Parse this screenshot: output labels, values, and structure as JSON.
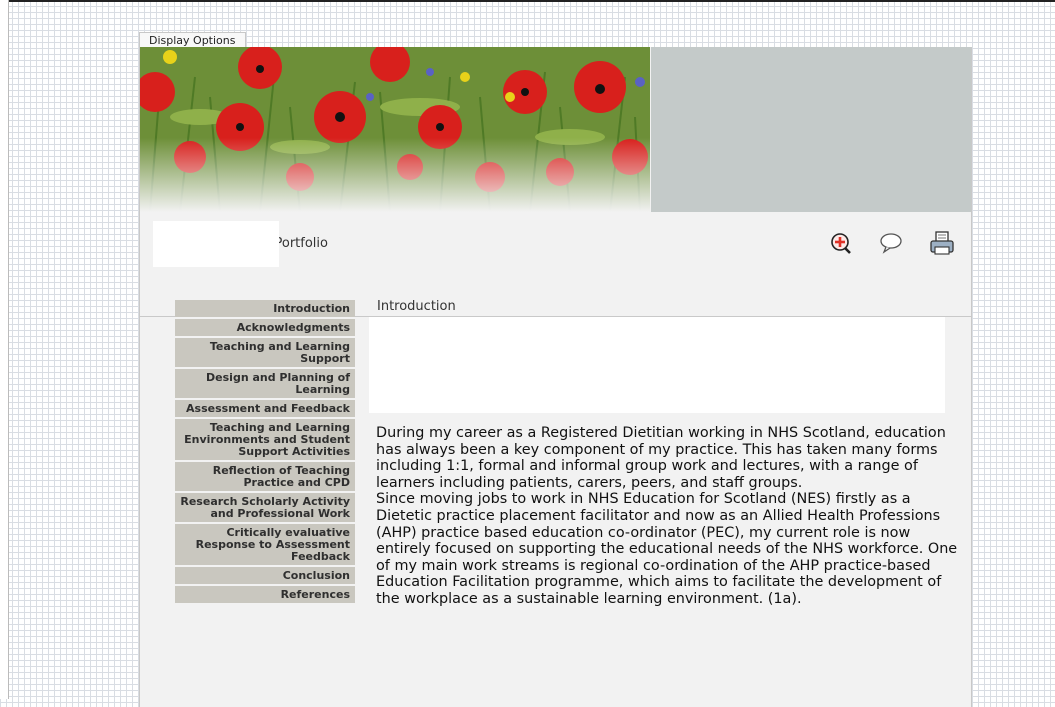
{
  "display_options_tab": "Display Options",
  "header": {
    "title": "y Education in Action Portfolio"
  },
  "toolbar": {
    "icons": [
      "zoom-in-icon",
      "comment-icon",
      "print-icon"
    ]
  },
  "nav": {
    "items": [
      "Introduction",
      "Acknowledgments",
      "Teaching and Learning Support",
      "Design and Planning of Learning",
      "Assessment and Feedback",
      "Teaching and Learning Environments and Student Support Activities",
      "Reflection of Teaching Practice and CPD",
      "Research Scholarly Activity and Professional Work",
      "Critically evaluative Response to Assessment Feedback",
      "Conclusion",
      "References"
    ]
  },
  "content": {
    "section_title": "Introduction",
    "paragraphs": [
      "During my career as a Registered Dietitian working in NHS Scotland, education has always been a key component of my practice. This has taken many forms including 1:1, formal and informal group work and lectures, with a range of learners including patients, carers, peers, and staff groups.",
      "Since moving jobs to work in NHS Education for Scotland (NES) firstly as a Dietetic practice placement facilitator and now as an Allied Health Professions (AHP) practice based education co-ordinator (PEC), my current role is now entirely focused on supporting the educational needs of the NHS workforce. One of my main work streams is regional co-ordination of the AHP practice-based Education Facilitation programme, which aims to facilitate the development of the workplace as a sustainable learning environment. (1a)."
    ]
  },
  "colors": {
    "nav_bg": "#c9c7bf",
    "panel_bg": "#f2f2f2",
    "banner_grey": "#c4cac9",
    "poppy_red": "#d8201c"
  }
}
